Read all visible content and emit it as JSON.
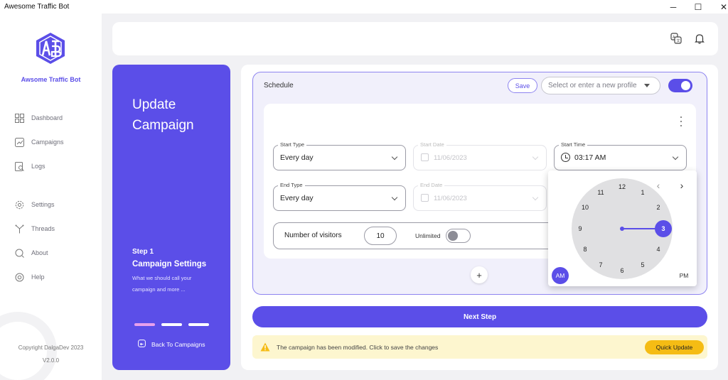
{
  "window": {
    "title": "Awesome Traffic Bot",
    "controls": [
      "─",
      "☐",
      "✕"
    ]
  },
  "sidebar": {
    "brand": "Awsome Traffic Bot",
    "items": [
      {
        "label": "Dashboard",
        "icon": "dashboard-icon"
      },
      {
        "label": "Campaigns",
        "icon": "campaigns-icon"
      },
      {
        "label": "Logs",
        "icon": "logs-icon"
      },
      {
        "label": "Settings",
        "icon": "gear-icon"
      },
      {
        "label": "Threads",
        "icon": "threads-icon"
      },
      {
        "label": "About",
        "icon": "about-icon"
      },
      {
        "label": "Help",
        "icon": "help-icon"
      }
    ],
    "copyright": "Copyright DalgaDev 2023",
    "version": "V2.0.0"
  },
  "left_panel": {
    "title": "Update Campaign",
    "step": "Step 1",
    "step_name": "Campaign Settings",
    "step_desc": "What we should call your campaign and more ...",
    "back": "Back To Campaigns",
    "steps_total": 3,
    "active_step": 1
  },
  "schedule": {
    "label": "Schedule",
    "save": "Save",
    "profile_placeholder": "Select or enter a new profile",
    "enabled": true,
    "start_type": {
      "label": "Start Type",
      "value": "Every day"
    },
    "start_date": {
      "label": "Start Date",
      "value": "11/06/2023"
    },
    "start_time": {
      "label": "Start Time",
      "value": "03:17 AM"
    },
    "end_type": {
      "label": "End Type",
      "value": "Every day"
    },
    "end_date": {
      "label": "End Date",
      "value": "11/06/2023"
    },
    "visitors_label": "Number of visitors",
    "visitors_value": "10",
    "unlimited_label": "Unlimited",
    "unlimited": false,
    "add": "+"
  },
  "clock": {
    "hours": [
      "12",
      "1",
      "2",
      "3",
      "4",
      "5",
      "6",
      "7",
      "8",
      "9",
      "10",
      "11"
    ],
    "selected_hour": "3",
    "am": "AM",
    "pm": "PM",
    "prev": "‹",
    "next": "›"
  },
  "next_step": "Next Step",
  "alert": {
    "text": "The campaign has been modified. Click to save the changes",
    "button": "Quick Update"
  },
  "colors": {
    "accent": "#5b4ee8",
    "warning": "#f5bc14",
    "alert_bg": "#fdf6cf"
  }
}
